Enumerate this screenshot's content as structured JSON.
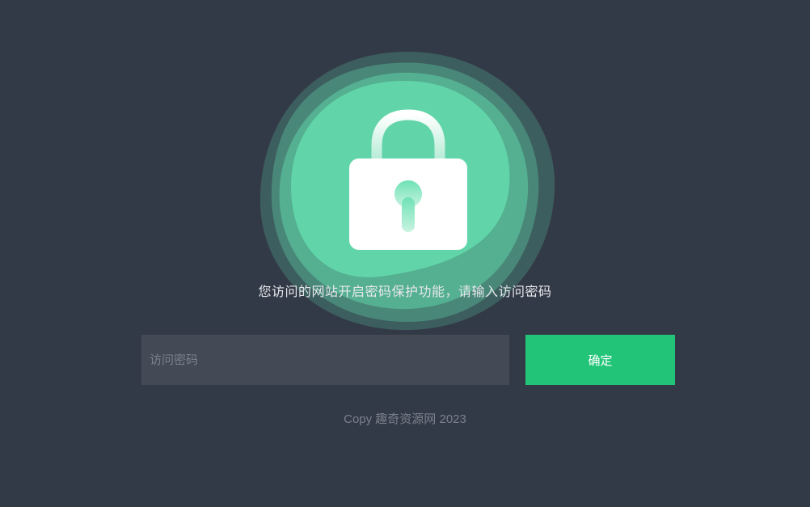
{
  "message": "您访问的网站开启密码保护功能，请输入访问密码",
  "password_field": {
    "value": "",
    "placeholder": "访问密码"
  },
  "confirm_button": {
    "label": "确定"
  },
  "footer": {
    "text": "Copy 趣奇资源网 2023"
  },
  "icons": {
    "lock": "padlock-icon"
  },
  "colors": {
    "background": "#333a47",
    "accent": "#22c578",
    "blob": "#63e0b0",
    "input_background": "#434955"
  }
}
